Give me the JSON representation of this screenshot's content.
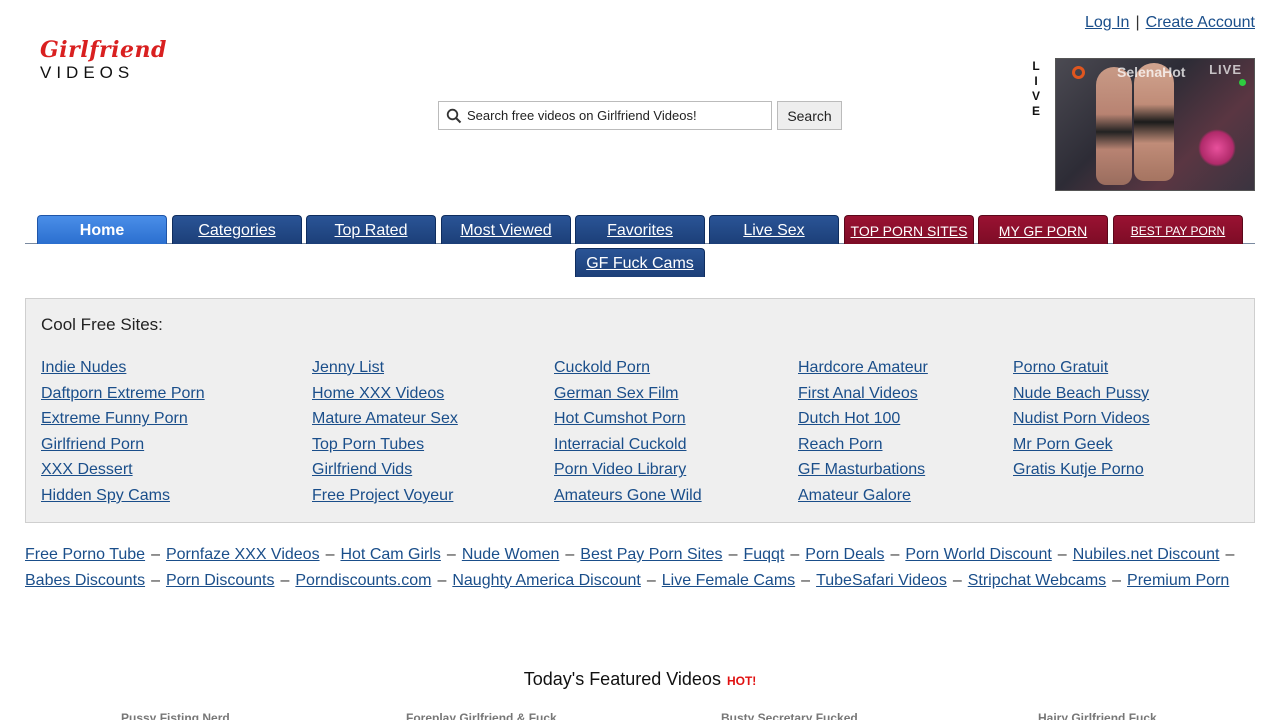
{
  "logo": {
    "top": "Girlfriend",
    "bottom": "VIDEOS"
  },
  "account": {
    "login": "Log In",
    "separator": "|",
    "create": "Create Account"
  },
  "search": {
    "placeholder": "Search free videos on Girlfriend Videos!",
    "button": "Search",
    "icon": "search-icon"
  },
  "live": {
    "letters": [
      "L",
      "I",
      "V",
      "E"
    ],
    "performer": "SelenaHot",
    "tag": "LIVE"
  },
  "nav": {
    "tabs": [
      {
        "label": "Home"
      },
      {
        "label": "Categories"
      },
      {
        "label": "Top Rated"
      },
      {
        "label": "Most Viewed"
      },
      {
        "label": "Favorites"
      },
      {
        "label": "Live Sex"
      },
      {
        "label": "TOP PORN SITES"
      },
      {
        "label": "MY GF PORN"
      },
      {
        "label": "BEST PAY PORN SITES"
      },
      {
        "label": "GF Fuck Cams"
      }
    ]
  },
  "cool_sites": {
    "heading": "Cool Free Sites:",
    "columns": [
      [
        "Indie Nudes",
        "Daftporn Extreme Porn",
        "Extreme Funny Porn",
        "Girlfriend Porn",
        "XXX Dessert",
        "Hidden Spy Cams"
      ],
      [
        "Jenny List",
        "Home XXX Videos",
        "Mature Amateur Sex",
        "Top Porn Tubes",
        "Girlfriend Vids",
        "Free Project Voyeur"
      ],
      [
        "Cuckold Porn",
        "German Sex Film",
        "Hot Cumshot Porn",
        "Interracial Cuckold",
        "Porn Video Library",
        "Amateurs Gone Wild"
      ],
      [
        "Hardcore Amateur",
        "First Anal Videos",
        "Dutch Hot 100",
        "Reach Porn",
        "GF Masturbations",
        "Amateur Galore"
      ],
      [
        "Porno Gratuit",
        "Nude Beach Pussy",
        "Nudist Porn Videos",
        "Mr Porn Geek",
        "Gratis Kutje Porno"
      ]
    ]
  },
  "link_row": {
    "separator": "–",
    "links": [
      "Free Porno Tube",
      "Pornfaze XXX Videos",
      "Hot Cam Girls",
      "Nude Women",
      "Best Pay Porn Sites",
      "Fuqqt",
      "Porn Deals",
      "Porn World Discount",
      "Nubiles.net Discount",
      "Babes Discounts",
      "Porn Discounts",
      "Porndiscounts.com",
      "Naughty America Discount",
      "Live Female Cams",
      "TubeSafari Videos",
      "Stripchat Webcams",
      "Premium Porn"
    ]
  },
  "featured": {
    "title": "Today's Featured Videos",
    "hot": "HOT!",
    "videos": [
      "Pussy Fisting Nerd",
      "Foreplay Girlfriend & Fuck",
      "Busty Secretary Fucked",
      "Hairy Girlfriend Fuck"
    ]
  }
}
